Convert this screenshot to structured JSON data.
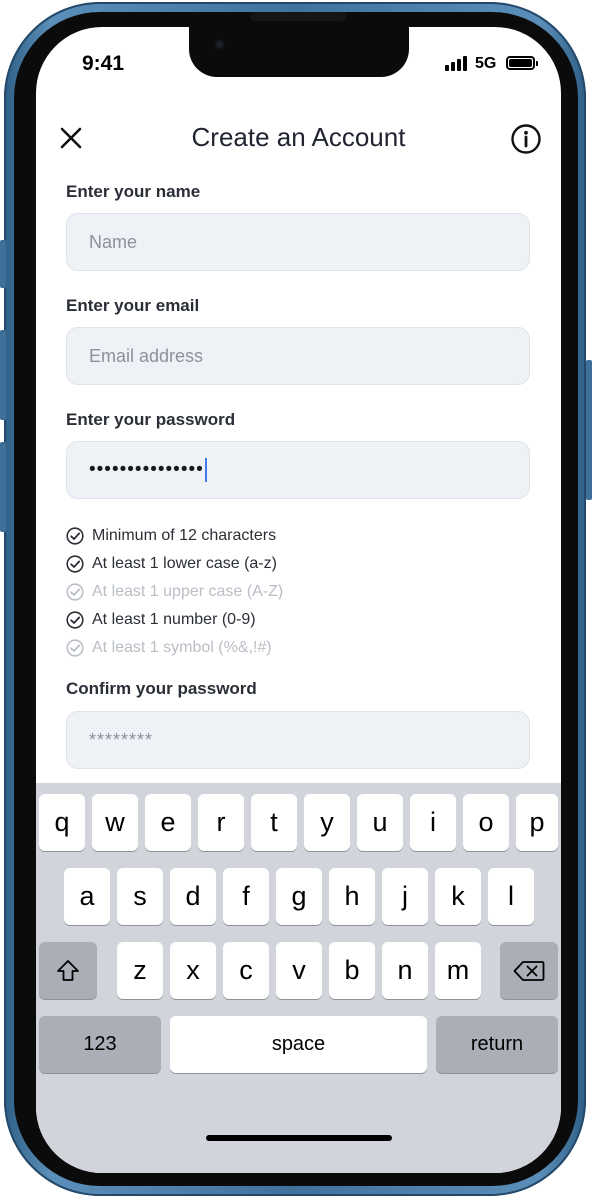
{
  "status_bar": {
    "time": "9:41",
    "network": "5G"
  },
  "header": {
    "title": "Create an Account"
  },
  "form": {
    "name_label": "Enter your name",
    "name_placeholder": "Name",
    "email_label": "Enter your email",
    "email_placeholder": "Email address",
    "password_label": "Enter your password",
    "password_value": "•••••••••••••••",
    "requirements": [
      {
        "text": "Minimum of 12 characters",
        "met": true
      },
      {
        "text": "At least 1 lower case (a-z)",
        "met": true
      },
      {
        "text": "At least 1 upper case (A-Z)",
        "met": false
      },
      {
        "text": "At least 1 number (0-9)",
        "met": true
      },
      {
        "text": "At least 1 symbol (%&,!#)",
        "met": false
      }
    ],
    "confirm_label": "Confirm your password",
    "confirm_placeholder": "********"
  },
  "keyboard": {
    "row1": [
      "q",
      "w",
      "e",
      "r",
      "t",
      "y",
      "u",
      "i",
      "o",
      "p"
    ],
    "row2": [
      "a",
      "s",
      "d",
      "f",
      "g",
      "h",
      "j",
      "k",
      "l"
    ],
    "row3": [
      "z",
      "x",
      "c",
      "v",
      "b",
      "n",
      "m"
    ],
    "numbers_label": "123",
    "space_label": "space",
    "return_label": "return"
  },
  "colors": {
    "frame": "#3f729c",
    "field_bg": "#eef1f5",
    "keyboard_bg": "#d1d4da",
    "requirement_met": "#2b2f36",
    "requirement_unmet": "#b9bec6"
  }
}
